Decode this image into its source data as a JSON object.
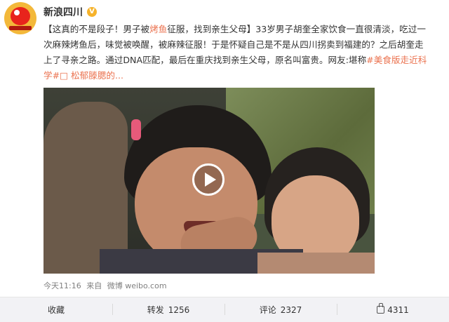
{
  "account": {
    "name": "新浪四川",
    "verified_icon": "verified-badge-icon"
  },
  "post": {
    "line1_a": "【这真的不是段子！男子被",
    "line1_hl": "烤鱼",
    "line1_b": "征服，找到亲生父母】33岁男子胡奎全家饮食一直很清淡，吃过一",
    "line2": "次麻辣烤鱼后，味觉被唤醒，被麻辣征服！于是怀疑自己是不是从四川拐卖到福建的？之后胡奎走",
    "line3_a": "上了寻亲之路。通过DNA匹配，最后在重庆找到亲生父母，原名叫富贵。网友:堪称",
    "line3_link": "#美食版走近科",
    "line4_link": "学#",
    "line4_user": "□ 松郁滕腮的..."
  },
  "media": {
    "play_icon": "play-icon"
  },
  "meta": {
    "time": "今天11:16",
    "source_prefix": "来自",
    "source": "微博 weibo.com"
  },
  "actions": {
    "favorite_label": "收藏",
    "repost_label": "转发",
    "repost_count": "1256",
    "comment_label": "评论",
    "comment_count": "2327",
    "like_count": "4311"
  },
  "colors": {
    "highlight": "#eb7350",
    "action_bar_bg": "#f2f2f5"
  }
}
